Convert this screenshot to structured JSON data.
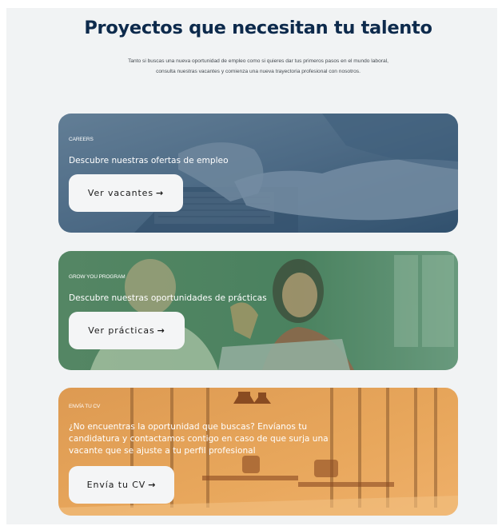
{
  "header": {
    "title": "Proyectos que necesitan tu talento",
    "subtitle": "Tanto si buscas una nueva oportunidad de empleo como si quieres dar tus primeros pasos en el mundo laboral, consulta nuestras vacantes y comienza una nueva trayectoria profesional con nosotros."
  },
  "cards": [
    {
      "eyebrow": "CAREERS",
      "heading": "Descubre nuestras ofertas de empleo",
      "button_label": "Ver vacantes",
      "arrow": "→",
      "overlay_color": "#2f4f6d"
    },
    {
      "eyebrow": "GROW YOU PROGRAM",
      "heading": "Descubre nuestras oportunidades de prácticas",
      "button_label": "Ver prácticas",
      "arrow": "→",
      "overlay_color": "#3d7a57"
    },
    {
      "eyebrow": "ENVÍA TU CV",
      "heading": "¿No encuentras la oportunidad que buscas? Envíanos tu candidatura y contactamos contigo en caso de que surja una vacante que se ajuste a tu perfil profesional",
      "button_label": "Envía tu CV",
      "arrow": "→",
      "overlay_color": "#e8a457"
    }
  ]
}
